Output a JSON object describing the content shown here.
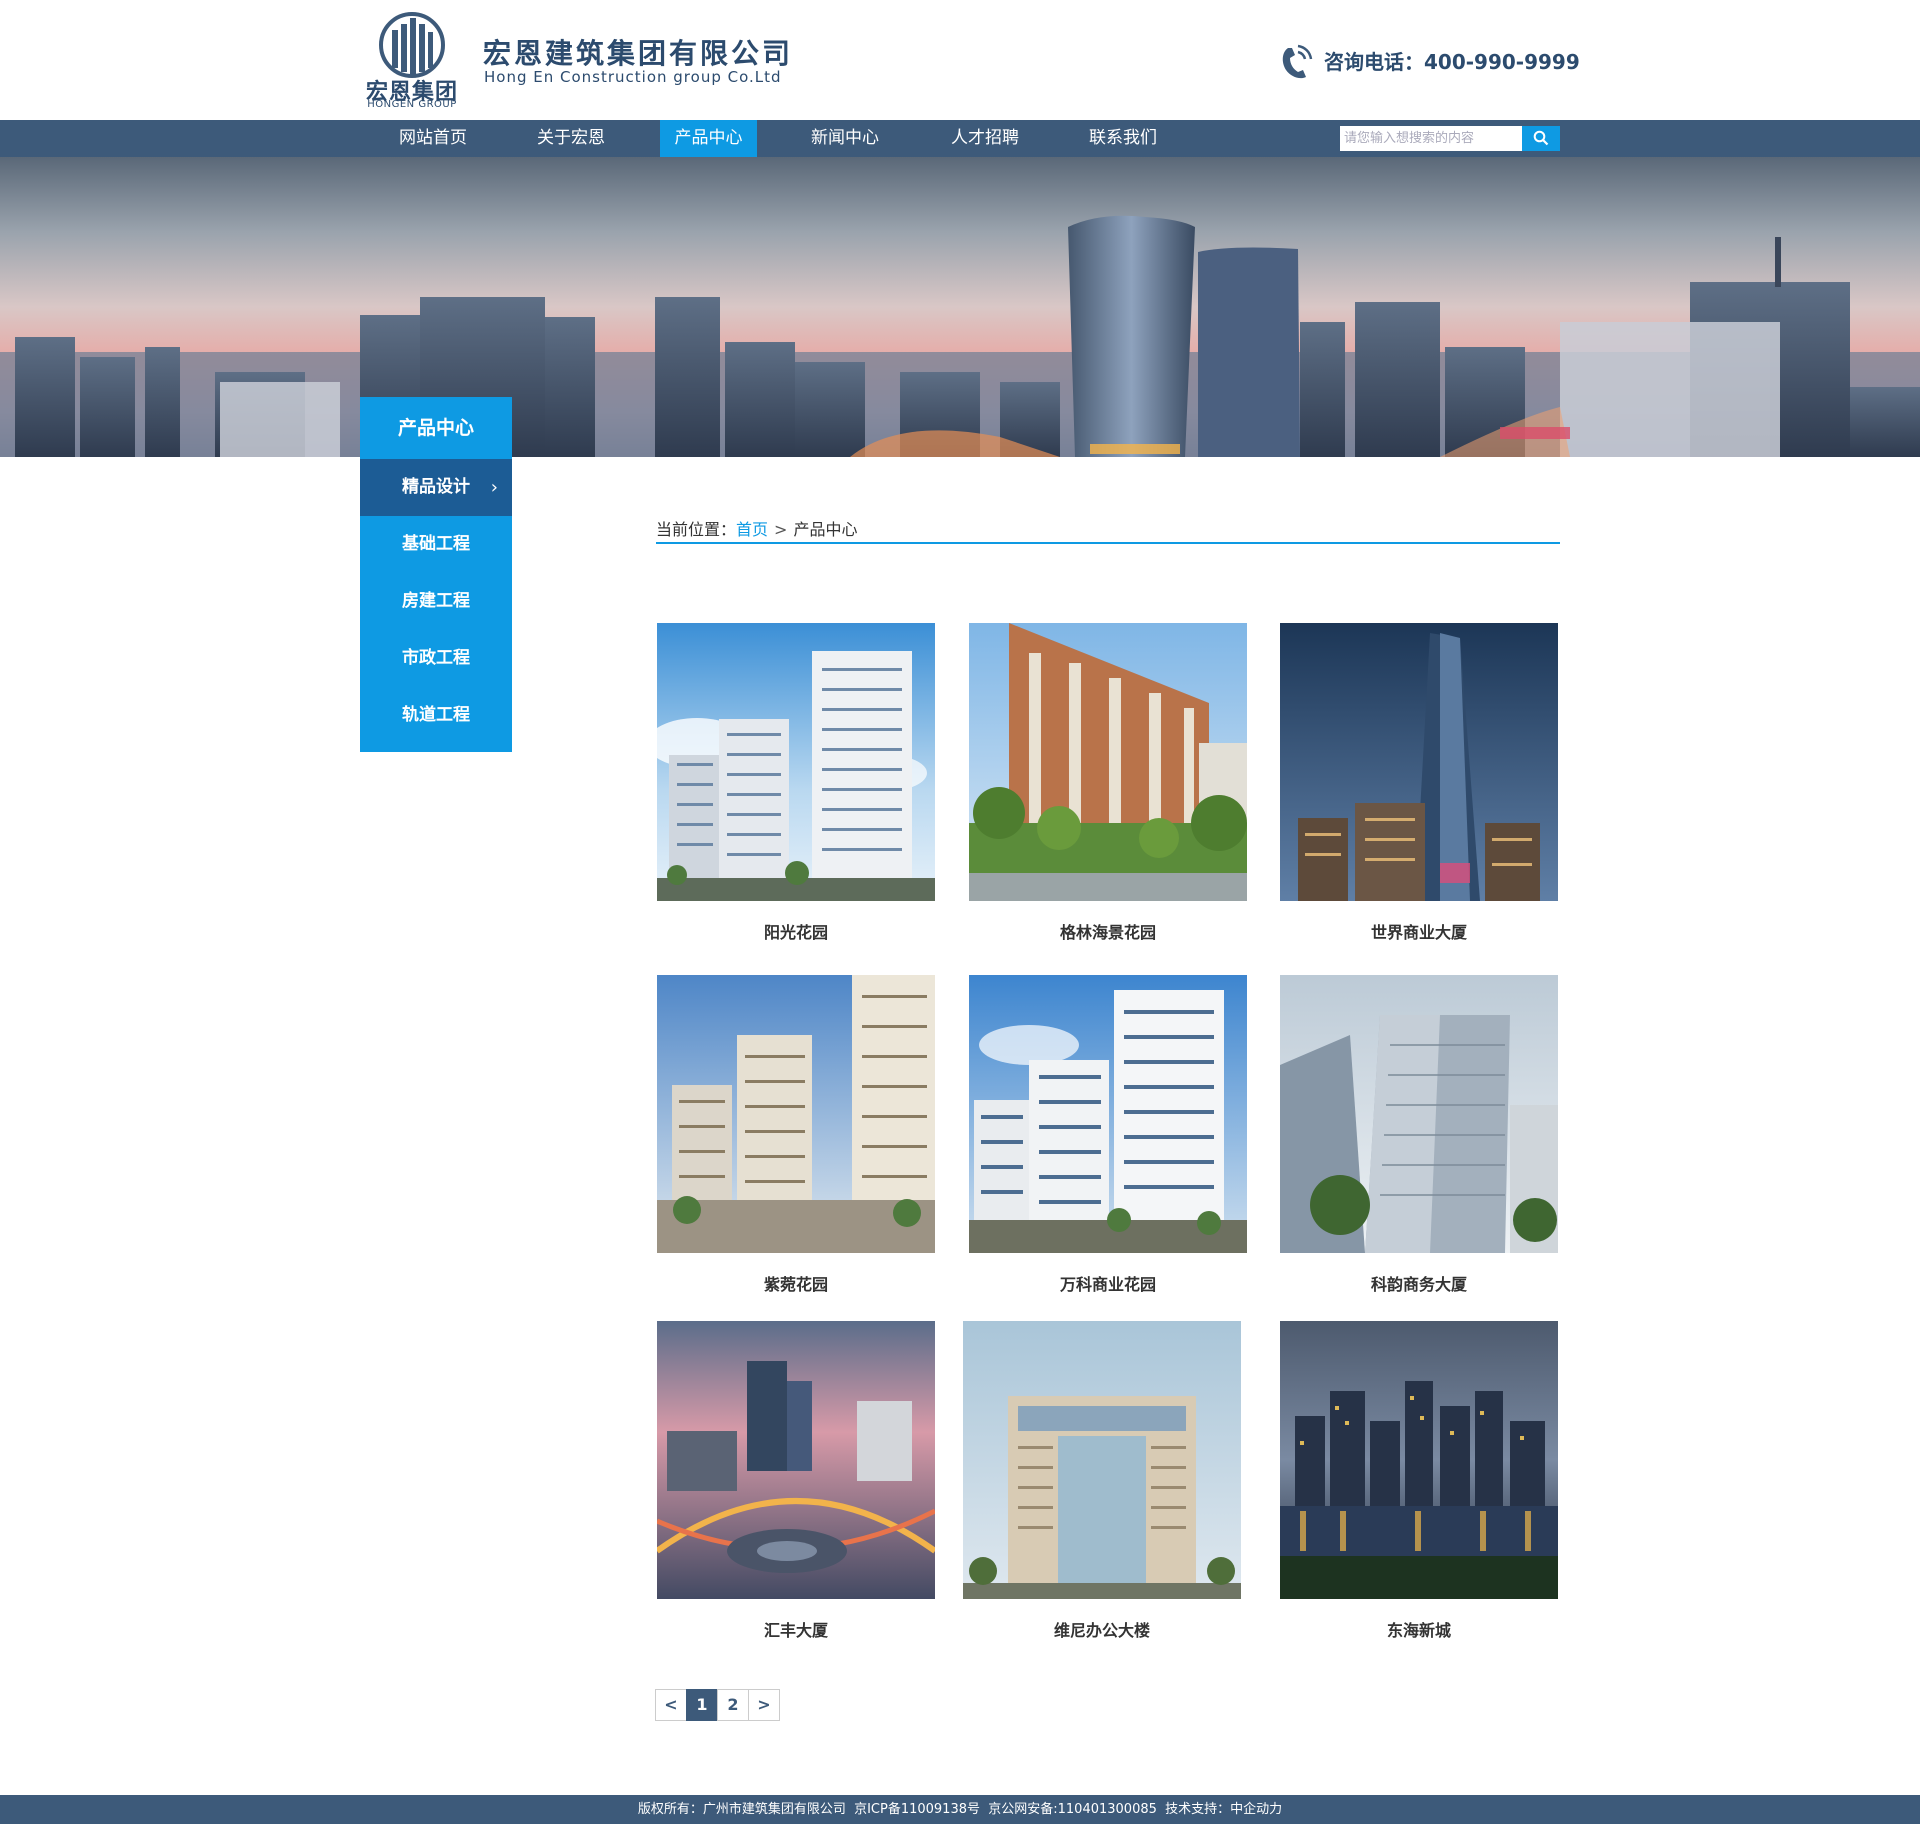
{
  "header": {
    "logo_cn": "宏恩集团",
    "logo_en": "HONGEN GROUP",
    "company_name_cn": "宏恩建筑集团有限公司",
    "company_name_en": "Hong En Construction group Co.Ltd",
    "phone_label": "咨询电话：400-990-9999"
  },
  "nav": {
    "items": [
      {
        "label": "网站首页"
      },
      {
        "label": "关于宏恩"
      },
      {
        "label": "产品中心"
      },
      {
        "label": "新闻中心"
      },
      {
        "label": "人才招聘"
      },
      {
        "label": "联系我们"
      }
    ],
    "active_index": 2,
    "search_placeholder": "请您输入想搜索的内容"
  },
  "side_menu": {
    "title": "产品中心",
    "items": [
      {
        "label": "精品设计",
        "active": true
      },
      {
        "label": "基础工程"
      },
      {
        "label": "房建工程"
      },
      {
        "label": "市政工程"
      },
      {
        "label": "轨道工程"
      }
    ]
  },
  "breadcrumb": {
    "prefix": "当前位置：",
    "home": "首页",
    "separator": ">",
    "current": "产品中心"
  },
  "products": [
    {
      "name": "阳光花园",
      "scene": "residential-towers-sky"
    },
    {
      "name": "格林海景花园",
      "scene": "residential-garden"
    },
    {
      "name": "世界商业大厦",
      "scene": "skyscraper-dusk"
    },
    {
      "name": "紫菀花园",
      "scene": "residential-towers-cloudy"
    },
    {
      "name": "万科商业花园",
      "scene": "residential-towers-blue"
    },
    {
      "name": "科韵商务大厦",
      "scene": "office-towers"
    },
    {
      "name": "汇丰大厦",
      "scene": "city-interchange"
    },
    {
      "name": "维尼办公大楼",
      "scene": "gate-building"
    },
    {
      "name": "东海新城",
      "scene": "night-skyline"
    }
  ],
  "pagination": {
    "prev": "<",
    "pages": [
      "1",
      "2"
    ],
    "current": "1",
    "next": ">"
  },
  "footer": {
    "text": "版权所有：广州市建筑集团有限公司  京ICP备11009138号  京公网安备:110401300085  技术支持：中企动力"
  },
  "colors": {
    "nav_bg": "#3d5a7a",
    "accent": "#0e9ae3",
    "side_active": "#1c5c95",
    "brand_text": "#2c4b6e"
  }
}
